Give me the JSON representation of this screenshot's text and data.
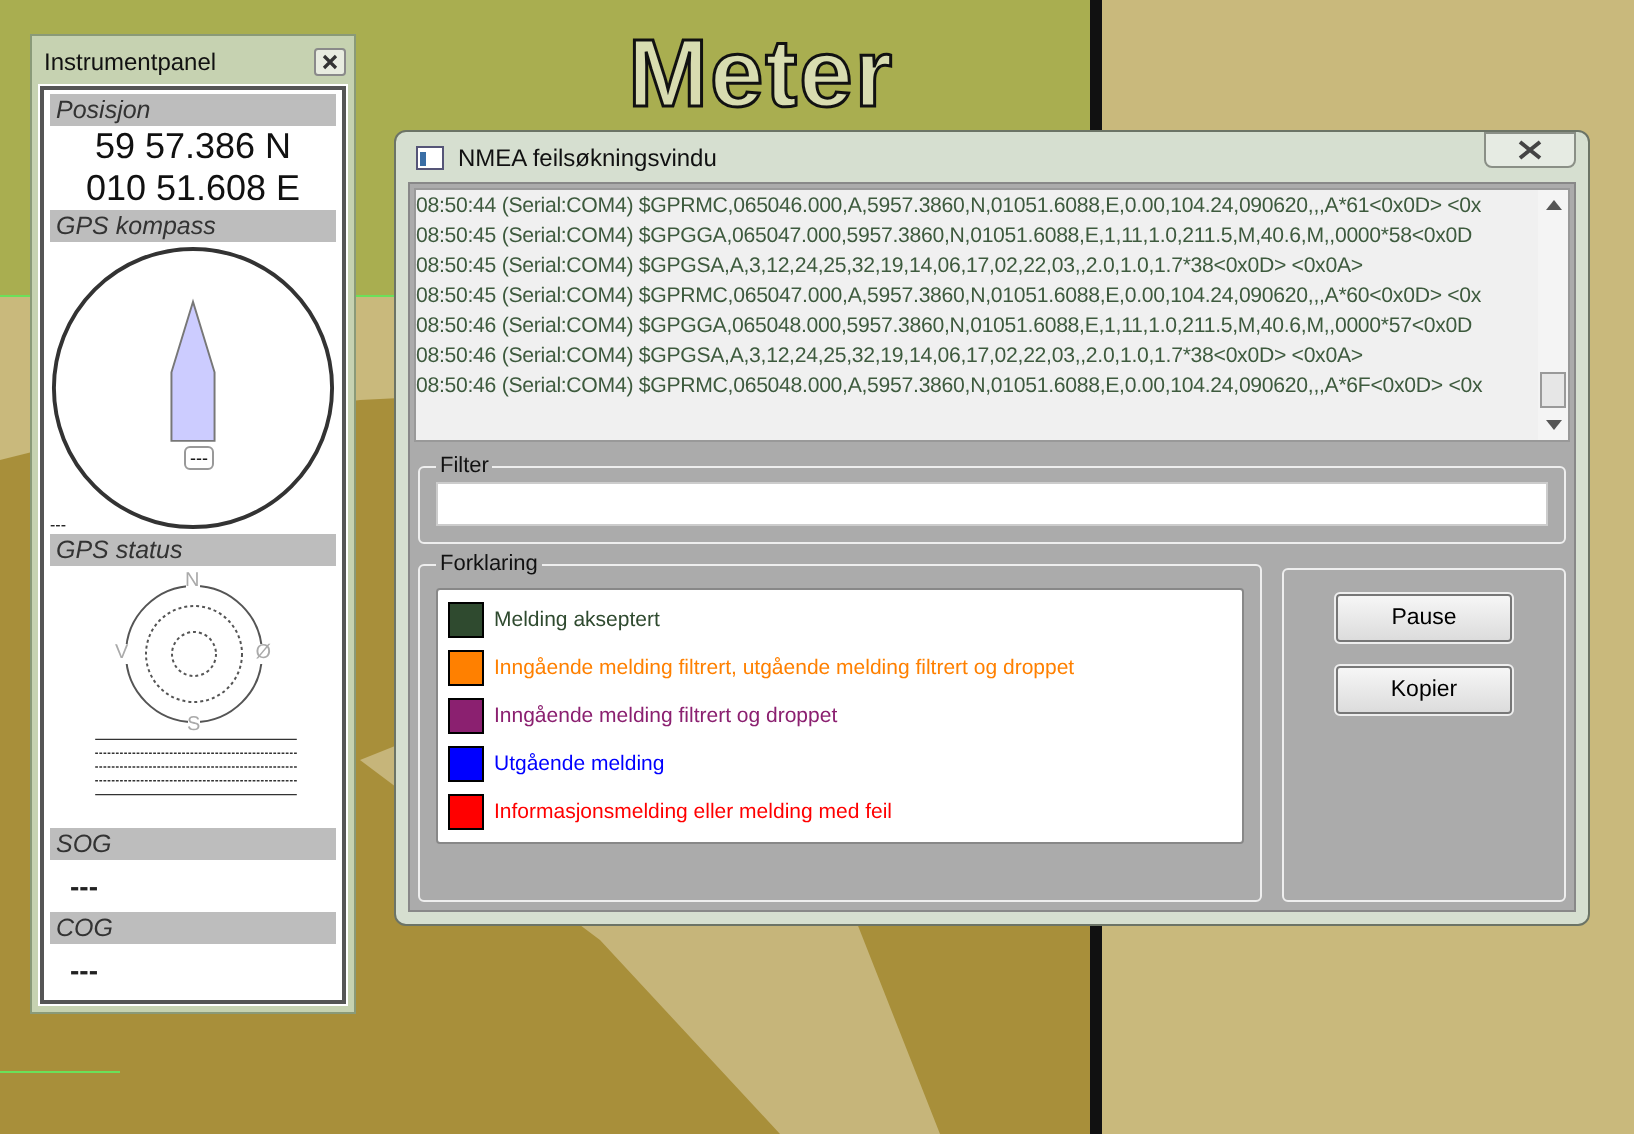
{
  "map": {
    "label": "Meter"
  },
  "instrument_panel": {
    "title": "Instrumentpanel",
    "position": {
      "heading": "Posisjon",
      "lines": [
        "59 57.386 N",
        "010 51.608 E"
      ]
    },
    "compass": {
      "heading": "GPS kompass",
      "needle_label": "---",
      "corner_label": "---"
    },
    "gps_status": {
      "heading": "GPS status",
      "directions": [
        "N",
        "Ø",
        "S",
        "V"
      ]
    },
    "sog": {
      "heading": "SOG",
      "value": "---"
    },
    "cog": {
      "heading": "COG",
      "value": "---"
    }
  },
  "nmea_window": {
    "title": "NMEA feilsøkningsvindu",
    "log": [
      "08:50:44 (Serial:COM4) $GPRMC,065046.000,A,5957.3860,N,01051.6088,E,0.00,104.24,090620,,,A*61<0x0D> <0x",
      "08:50:45 (Serial:COM4) $GPGGA,065047.000,5957.3860,N,01051.6088,E,1,11,1.0,211.5,M,40.6,M,,0000*58<0x0D",
      "08:50:45 (Serial:COM4) $GPGSA,A,3,12,24,25,32,19,14,06,17,02,22,03,,2.0,1.0,1.7*38<0x0D> <0x0A>",
      "08:50:45 (Serial:COM4) $GPRMC,065047.000,A,5957.3860,N,01051.6088,E,0.00,104.24,090620,,,A*60<0x0D> <0x",
      "08:50:46 (Serial:COM4) $GPGGA,065048.000,5957.3860,N,01051.6088,E,1,11,1.0,211.5,M,40.6,M,,0000*57<0x0D",
      "08:50:46 (Serial:COM4) $GPGSA,A,3,12,24,25,32,19,14,06,17,02,22,03,,2.0,1.0,1.7*38<0x0D> <0x0A>",
      "08:50:46 (Serial:COM4) $GPRMC,065048.000,A,5957.3860,N,01051.6088,E,0.00,104.24,090620,,,A*6F<0x0D> <0x"
    ],
    "filter": {
      "label": "Filter"
    },
    "legend": {
      "label": "Forklaring",
      "items": [
        {
          "text": "Melding akseptert",
          "color": "#2f4a2f"
        },
        {
          "text": "Inngående melding filtrert, utgående melding filtrert og droppet",
          "color": "#ff8000"
        },
        {
          "text": "Inngående melding filtrert og droppet",
          "color": "#8b2070"
        },
        {
          "text": "Utgående melding",
          "color": "#0000ff"
        },
        {
          "text": "Informasjonsmelding eller melding med feil",
          "color": "#ff0000"
        }
      ]
    },
    "buttons": [
      "Pause",
      "Kopier"
    ]
  }
}
